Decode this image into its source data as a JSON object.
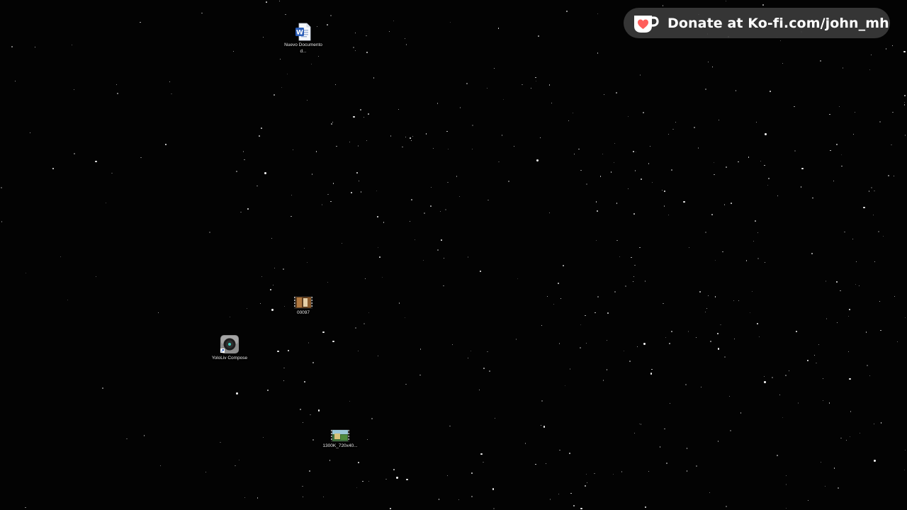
{
  "desktop": {
    "background_color": "#030303",
    "icons": [
      {
        "label": "Nuevo Documento d...",
        "icon": "word-document-icon"
      },
      {
        "label": "00097",
        "icon": "video-thumbnail-icon"
      },
      {
        "label": "YoloLiv Compose",
        "icon": "yololiv-compose-icon"
      },
      {
        "label": "1300K_720x40...",
        "icon": "video-thumbnail-icon"
      }
    ]
  },
  "overlay": {
    "donate_text": "Donate at Ko-fi.com/john_mh",
    "icon": "kofi-cup-icon",
    "accent_color": "#ff5e5b",
    "background_color": "#3a3a3a"
  }
}
